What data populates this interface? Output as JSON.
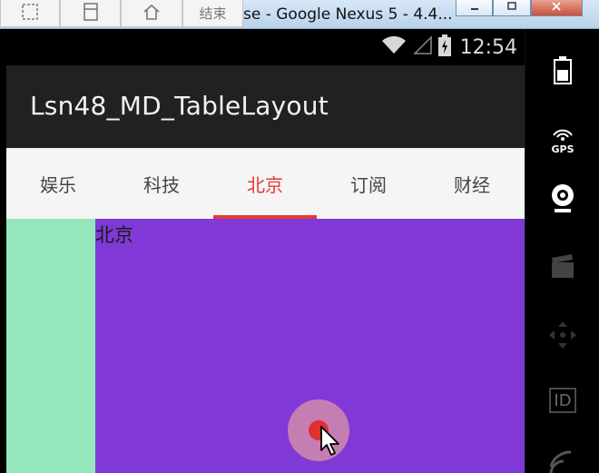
{
  "window": {
    "title": "se - Google Nexus 5 - 4.4...",
    "toolbar_buttons": [
      {
        "icon": "select-region-icon",
        "label": ""
      },
      {
        "icon": "save-icon",
        "label": ""
      },
      {
        "icon": "home-icon",
        "label": ""
      },
      {
        "icon": "end-icon",
        "label": "结束"
      }
    ]
  },
  "status_bar": {
    "time": "12:54"
  },
  "app_bar": {
    "title": "Lsn48_MD_TableLayout"
  },
  "tabs": [
    {
      "label": "娱乐",
      "active": false
    },
    {
      "label": "科技",
      "active": false
    },
    {
      "label": "北京",
      "active": true
    },
    {
      "label": "订阅",
      "active": false
    },
    {
      "label": "财经",
      "active": false
    }
  ],
  "content": {
    "label": "北京"
  },
  "side_panel": {
    "items": [
      "battery-icon",
      "gps-icon",
      "webcam-icon",
      "clapper-icon",
      "dpad-icon",
      "id-icon",
      "wifi-icon"
    ],
    "gps_label": "GPS",
    "id_label": "ID"
  },
  "colors": {
    "accent": "#e53935",
    "appbar": "#212121",
    "content_bg": "#8039d6",
    "strip_bg": "#94e7bd"
  }
}
